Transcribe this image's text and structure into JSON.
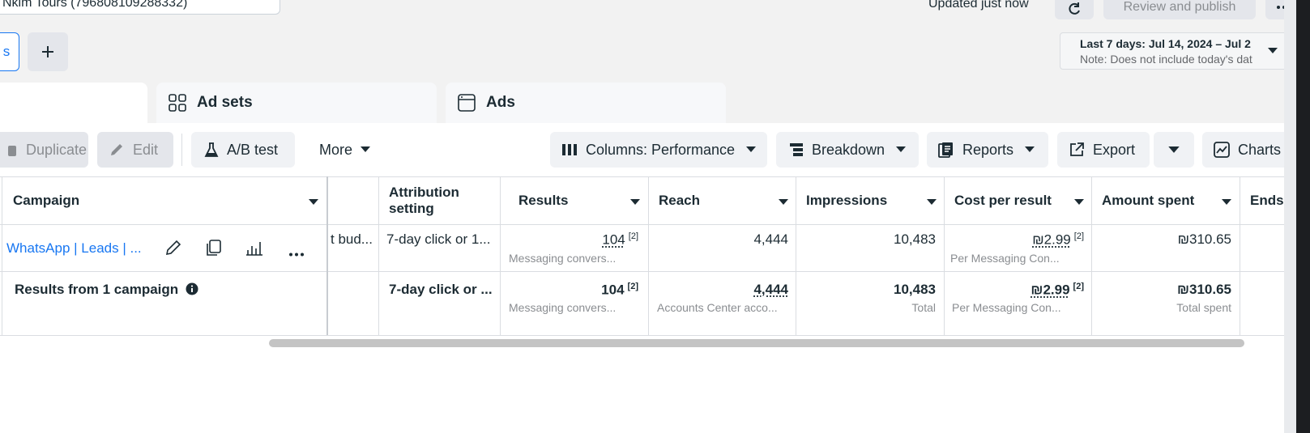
{
  "header": {
    "account_label": "Nkim Tours (796808109288332)",
    "updated_text": "Updated just now",
    "review_button": "Review and publish",
    "view_tab_label": "s",
    "date_range_line1": "Last 7 days: Jul 14, 2024 – Jul 2",
    "date_range_line2": "Note: Does not include today's dat"
  },
  "level_tabs": [
    {
      "label": "Ad sets",
      "icon": "adsets-grid-icon"
    },
    {
      "label": "Ads",
      "icon": "ads-window-icon"
    }
  ],
  "toolbar": {
    "duplicate": "Duplicate",
    "edit": "Edit",
    "ab_test": "A/B test",
    "more": "More",
    "columns": "Columns: Performance",
    "breakdown": "Breakdown",
    "reports": "Reports",
    "export": "Export",
    "charts": "Charts"
  },
  "table": {
    "columns": {
      "campaign": "Campaign",
      "attribution": "Attribution setting",
      "results": "Results",
      "reach": "Reach",
      "impressions": "Impressions",
      "cost_per_result": "Cost per result",
      "amount_spent": "Amount spent",
      "ends": "Ends"
    },
    "row": {
      "campaign_name": "WhatsApp | Leads | ...",
      "budget": "t bud...",
      "attribution": "7-day click or 1...",
      "results_value": "104",
      "results_sup": "[2]",
      "results_sub": "Messaging convers...",
      "reach": "4,444",
      "impressions": "10,483",
      "cost_value": "₪2.99",
      "cost_sup": "[2]",
      "cost_sub": "Per Messaging Con...",
      "amount_spent": "₪310.65"
    },
    "summary": {
      "label": "Results from 1 campaign",
      "attribution": "7-day click or ...",
      "results_value": "104",
      "results_sup": "[2]",
      "results_sub": "Messaging convers...",
      "reach": "4,444",
      "reach_sub": "Accounts Center acco...",
      "impressions": "10,483",
      "impressions_sub": "Total",
      "cost_value": "₪2.99",
      "cost_sup": "[2]",
      "cost_sub": "Per Messaging Con...",
      "amount_spent": "₪310.65",
      "amount_sub": "Total spent"
    }
  }
}
